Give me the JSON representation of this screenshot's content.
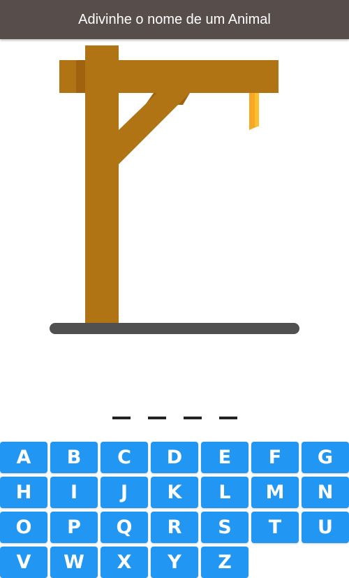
{
  "app_bar": {
    "title": "Adivinhe o nome de um Animal"
  },
  "word": {
    "slots": [
      "",
      "",
      "",
      ""
    ]
  },
  "keyboard": {
    "letters": [
      "A",
      "B",
      "C",
      "D",
      "E",
      "F",
      "G",
      "H",
      "I",
      "J",
      "K",
      "L",
      "M",
      "N",
      "O",
      "P",
      "Q",
      "R",
      "S",
      "T",
      "U",
      "V",
      "W",
      "X",
      "Y",
      "Z"
    ]
  },
  "colors": {
    "app_bar": "#574d4b",
    "key": "#2196f3",
    "wood": "#b07415",
    "wood_shadow": "#a0620e",
    "rope": "#f9a825",
    "ground": "#505050"
  }
}
